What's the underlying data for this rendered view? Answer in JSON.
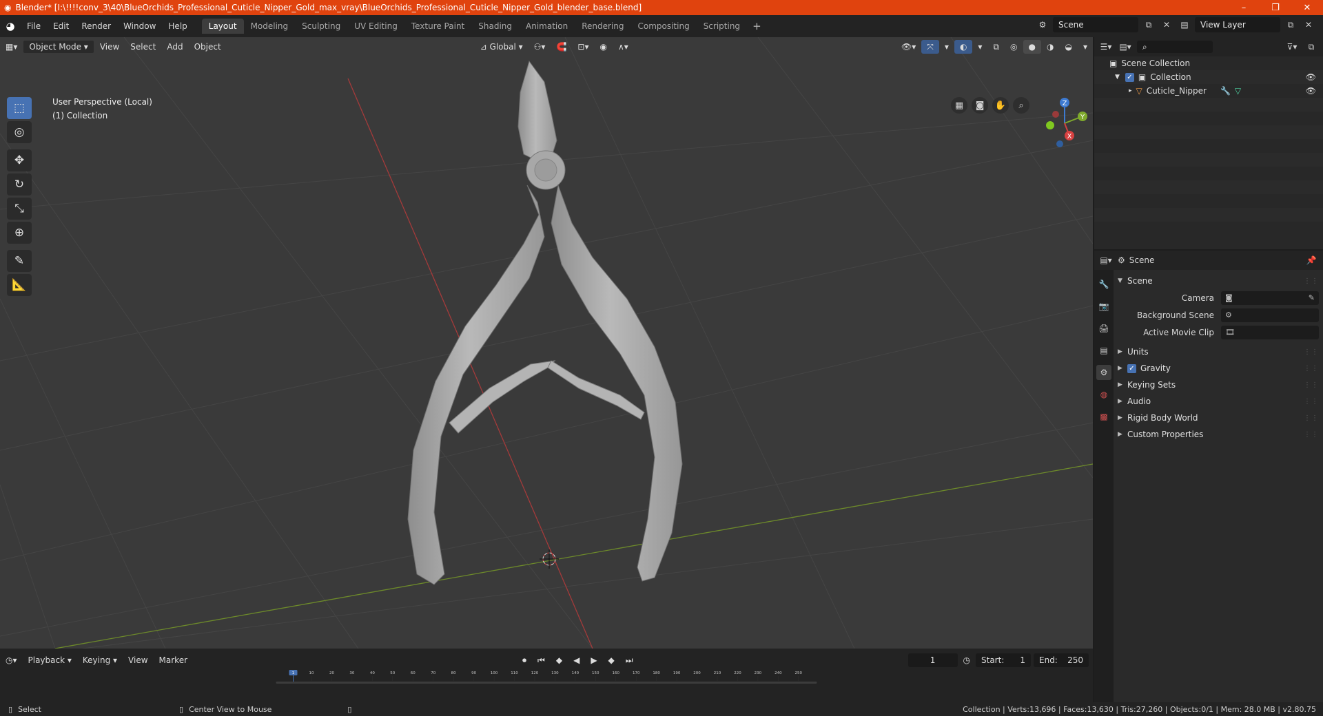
{
  "titlebar": {
    "title": "Blender* [I:\\!!!!conv_3\\40\\BlueOrchids_Professional_Cuticle_Nipper_Gold_max_vray\\BlueOrchids_Professional_Cuticle_Nipper_Gold_blender_base.blend]"
  },
  "menu": [
    "File",
    "Edit",
    "Render",
    "Window",
    "Help"
  ],
  "workspaces": [
    "Layout",
    "Modeling",
    "Sculpting",
    "UV Editing",
    "Texture Paint",
    "Shading",
    "Animation",
    "Rendering",
    "Compositing",
    "Scripting"
  ],
  "active_workspace": "Layout",
  "scene_field": "Scene",
  "view_layer_field": "View Layer",
  "viewport_header": {
    "mode": "Object Mode",
    "menus": [
      "View",
      "Select",
      "Add",
      "Object"
    ],
    "orientation": "Global"
  },
  "viewport": {
    "info_line1": "User Perspective (Local)",
    "info_line2": "(1) Collection"
  },
  "gizmo": {
    "z": "Z",
    "y": "Y",
    "x": "X"
  },
  "timeline": {
    "menus": [
      "Playback",
      "Keying",
      "View",
      "Marker"
    ],
    "current_frame": "1",
    "start_label": "Start:",
    "start": "1",
    "end_label": "End:",
    "end": "250",
    "ruler_labels": [
      "1",
      "10",
      "20",
      "30",
      "40",
      "50",
      "60",
      "70",
      "80",
      "90",
      "100",
      "110",
      "120",
      "130",
      "140",
      "150",
      "160",
      "170",
      "180",
      "190",
      "200",
      "210",
      "220",
      "230",
      "240",
      "250"
    ]
  },
  "statusbar": {
    "left1": "Select",
    "left2": "Center View to Mouse",
    "right": "Collection | Verts:13,696 | Faces:13,630 | Tris:27,260 | Objects:0/1 | Mem: 28.0 MB | v2.80.75"
  },
  "outliner": {
    "root": "Scene Collection",
    "collection": "Collection",
    "object": "Cuticle_Nipper"
  },
  "properties": {
    "header": "Scene",
    "panel_scene": "Scene",
    "camera_label": "Camera",
    "background_label": "Background Scene",
    "movieclip_label": "Active Movie Clip",
    "sections": [
      "Units",
      "Gravity",
      "Keying Sets",
      "Audio",
      "Rigid Body World",
      "Custom Properties"
    ]
  }
}
